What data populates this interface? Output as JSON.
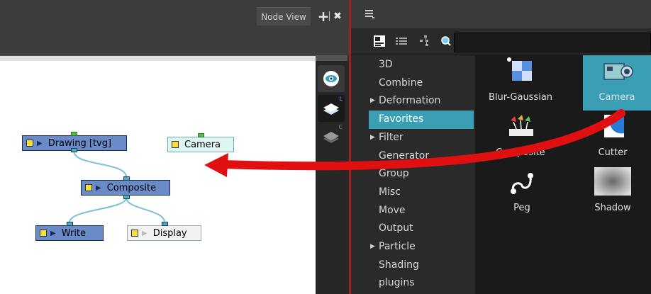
{
  "node_view": {
    "tab_label": "Node View",
    "nodes": {
      "drawing": "Drawing  [tvg]",
      "camera": "Camera",
      "composite": "Composite",
      "write": "Write",
      "display": "Display"
    },
    "side_toolbar": {
      "layer_letter": "L",
      "layer2_letter": "C"
    }
  },
  "library": {
    "categories": [
      {
        "label": "3D",
        "expandable": false
      },
      {
        "label": "Combine",
        "expandable": false
      },
      {
        "label": "Deformation",
        "expandable": true
      },
      {
        "label": "Favorites",
        "expandable": false,
        "selected": true
      },
      {
        "label": "Filter",
        "expandable": true
      },
      {
        "label": "Generator",
        "expandable": false
      },
      {
        "label": "Group",
        "expandable": false
      },
      {
        "label": "Misc",
        "expandable": false
      },
      {
        "label": "Move",
        "expandable": false
      },
      {
        "label": "Output",
        "expandable": false
      },
      {
        "label": "Particle",
        "expandable": true
      },
      {
        "label": "Shading",
        "expandable": false
      },
      {
        "label": "plugins",
        "expandable": false
      }
    ],
    "items": [
      {
        "label": "Blur-Gaussian",
        "icon": "blur-gaussian-icon"
      },
      {
        "label": "Camera",
        "icon": "camera-icon",
        "selected": true
      },
      {
        "label": "Composite",
        "icon": "composite-icon"
      },
      {
        "label": "Cutter",
        "icon": "cutter-icon"
      },
      {
        "label": "Peg",
        "icon": "peg-icon"
      },
      {
        "label": "Shadow",
        "icon": "shadow-icon"
      }
    ]
  },
  "colors": {
    "selection": "#3a9fb4",
    "drag_arrow": "#e01010",
    "node_blue": "#6a8ac8"
  }
}
